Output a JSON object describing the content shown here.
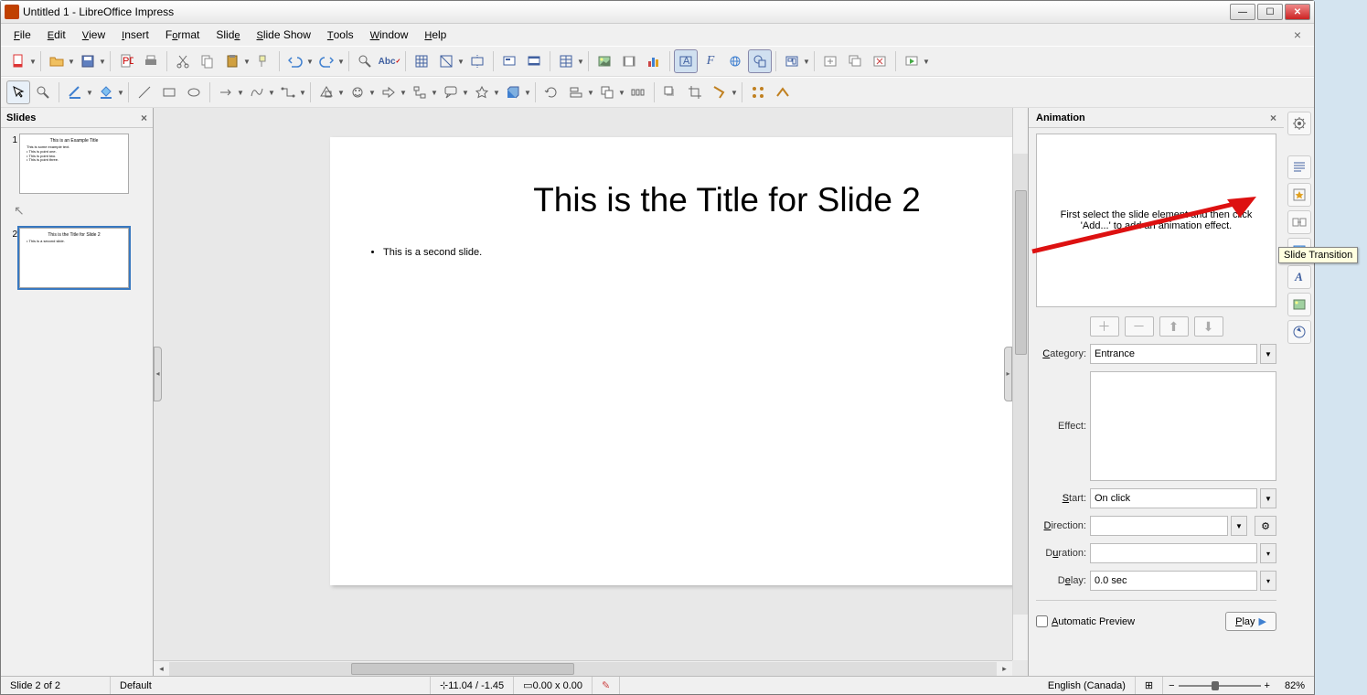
{
  "window": {
    "title": "Untitled 1 - LibreOffice Impress"
  },
  "menu": {
    "items": [
      "File",
      "Edit",
      "View",
      "Insert",
      "Format",
      "Slide",
      "Slide Show",
      "Tools",
      "Window",
      "Help"
    ],
    "underline": [
      0,
      0,
      0,
      0,
      1,
      4,
      6,
      0,
      0,
      0
    ]
  },
  "slides_panel": {
    "title": "Slides"
  },
  "thumbs": [
    {
      "n": "1",
      "title": "This is an Example Title",
      "body": [
        "This is some example text.",
        "• This is point one.",
        "• This is point two.",
        "• This is point three."
      ]
    },
    {
      "n": "2",
      "title": "This is the Title for Slide 2",
      "body": [
        "• This is a second slide."
      ]
    }
  ],
  "current_slide": {
    "title": "This is the Title for Slide 2",
    "bullet": "This is a second slide."
  },
  "animation_panel": {
    "title": "Animation",
    "hint": "First select the slide element and then click 'Add...' to add an animation effect.",
    "category_label": "Category:",
    "category_value": "Entrance",
    "effect_label": "Effect:",
    "start_label": "Start:",
    "start_value": "On click",
    "direction_label": "Direction:",
    "duration_label": "Duration:",
    "delay_label": "Delay:",
    "delay_value": "0.0 sec",
    "auto_preview": "Automatic Preview",
    "play": "Play"
  },
  "tooltip": "Slide Transition",
  "status": {
    "slide": "Slide 2 of 2",
    "master": "Default",
    "pos": "11.04 / -1.45",
    "size": "0.00 x 0.00",
    "lang": "English (Canada)",
    "zoom": "82%"
  }
}
